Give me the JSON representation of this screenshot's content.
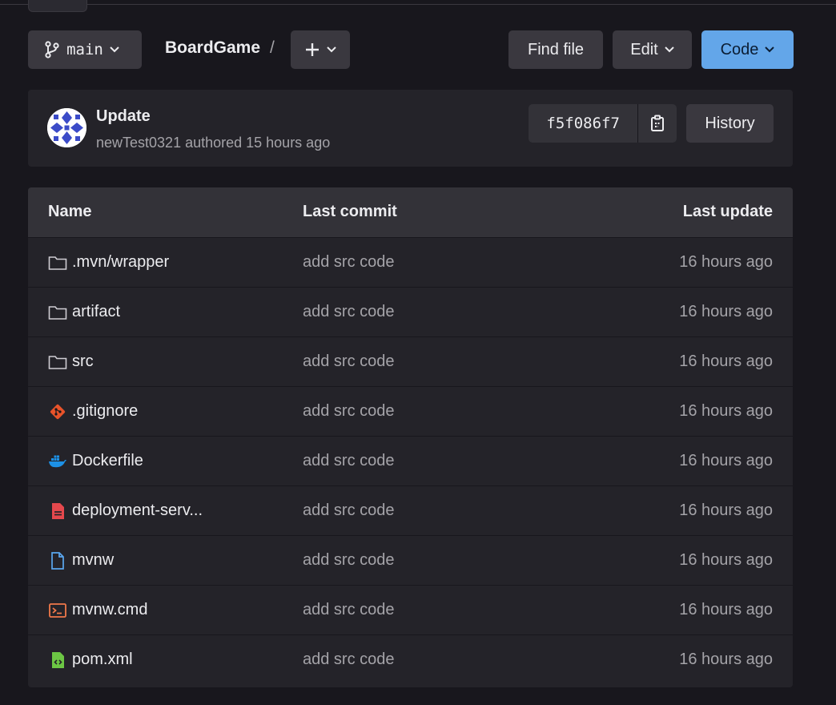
{
  "toolbar": {
    "branch": "main",
    "breadcrumb": "BoardGame",
    "separator": "/",
    "find_file": "Find file",
    "edit": "Edit",
    "code": "Code"
  },
  "commit": {
    "title": "Update",
    "author": "newTest0321",
    "meta": "newTest0321 authored 15 hours ago",
    "sha": "f5f086f7",
    "history": "History"
  },
  "table": {
    "headers": {
      "name": "Name",
      "last_commit": "Last commit",
      "last_update": "Last update"
    },
    "rows": [
      {
        "name": ".mvn/wrapper",
        "commit": "add src code",
        "updated": "16 hours ago",
        "icon": "folder-icon"
      },
      {
        "name": "artifact",
        "commit": "add src code",
        "updated": "16 hours ago",
        "icon": "folder-icon"
      },
      {
        "name": "src",
        "commit": "add src code",
        "updated": "16 hours ago",
        "icon": "folder-icon"
      },
      {
        "name": ".gitignore",
        "commit": "add src code",
        "updated": "16 hours ago",
        "icon": "git-icon"
      },
      {
        "name": "Dockerfile",
        "commit": "add src code",
        "updated": "16 hours ago",
        "icon": "docker-icon"
      },
      {
        "name": "deployment-serv...",
        "commit": "add src code",
        "updated": "16 hours ago",
        "icon": "yaml-file-icon"
      },
      {
        "name": "mvnw",
        "commit": "add src code",
        "updated": "16 hours ago",
        "icon": "file-icon"
      },
      {
        "name": "mvnw.cmd",
        "commit": "add src code",
        "updated": "16 hours ago",
        "icon": "terminal-icon"
      },
      {
        "name": "pom.xml",
        "commit": "add src code",
        "updated": "16 hours ago",
        "icon": "xml-file-icon"
      }
    ]
  },
  "colors": {
    "background": "#18171d",
    "card": "#242329",
    "button": "#3a383f",
    "primary": "#63a6e9",
    "muted_text": "#a4a3a8"
  }
}
